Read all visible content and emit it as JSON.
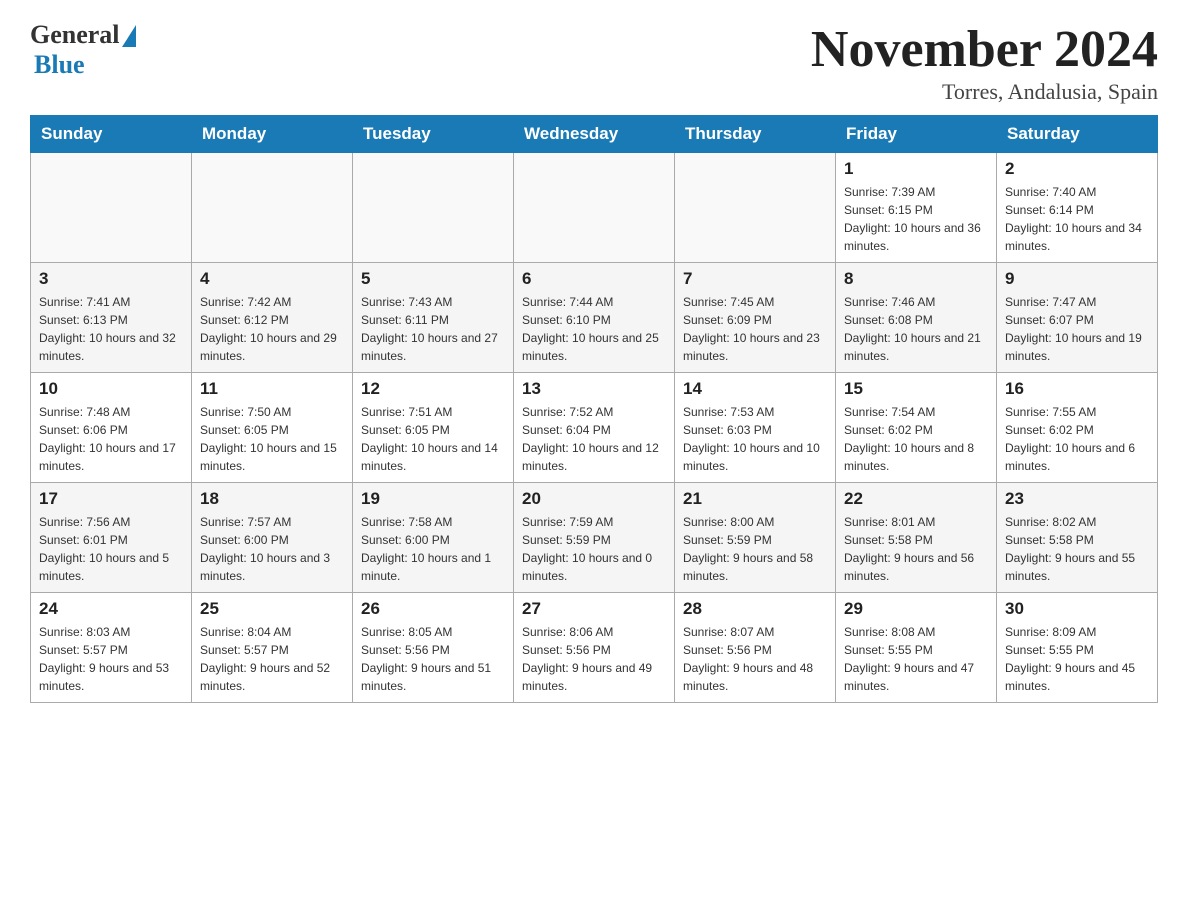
{
  "header": {
    "logo_general": "General",
    "logo_blue": "Blue",
    "month_title": "November 2024",
    "location": "Torres, Andalusia, Spain"
  },
  "weekdays": [
    "Sunday",
    "Monday",
    "Tuesday",
    "Wednesday",
    "Thursday",
    "Friday",
    "Saturday"
  ],
  "weeks": [
    [
      {
        "day": "",
        "info": ""
      },
      {
        "day": "",
        "info": ""
      },
      {
        "day": "",
        "info": ""
      },
      {
        "day": "",
        "info": ""
      },
      {
        "day": "",
        "info": ""
      },
      {
        "day": "1",
        "info": "Sunrise: 7:39 AM\nSunset: 6:15 PM\nDaylight: 10 hours and 36 minutes."
      },
      {
        "day": "2",
        "info": "Sunrise: 7:40 AM\nSunset: 6:14 PM\nDaylight: 10 hours and 34 minutes."
      }
    ],
    [
      {
        "day": "3",
        "info": "Sunrise: 7:41 AM\nSunset: 6:13 PM\nDaylight: 10 hours and 32 minutes."
      },
      {
        "day": "4",
        "info": "Sunrise: 7:42 AM\nSunset: 6:12 PM\nDaylight: 10 hours and 29 minutes."
      },
      {
        "day": "5",
        "info": "Sunrise: 7:43 AM\nSunset: 6:11 PM\nDaylight: 10 hours and 27 minutes."
      },
      {
        "day": "6",
        "info": "Sunrise: 7:44 AM\nSunset: 6:10 PM\nDaylight: 10 hours and 25 minutes."
      },
      {
        "day": "7",
        "info": "Sunrise: 7:45 AM\nSunset: 6:09 PM\nDaylight: 10 hours and 23 minutes."
      },
      {
        "day": "8",
        "info": "Sunrise: 7:46 AM\nSunset: 6:08 PM\nDaylight: 10 hours and 21 minutes."
      },
      {
        "day": "9",
        "info": "Sunrise: 7:47 AM\nSunset: 6:07 PM\nDaylight: 10 hours and 19 minutes."
      }
    ],
    [
      {
        "day": "10",
        "info": "Sunrise: 7:48 AM\nSunset: 6:06 PM\nDaylight: 10 hours and 17 minutes."
      },
      {
        "day": "11",
        "info": "Sunrise: 7:50 AM\nSunset: 6:05 PM\nDaylight: 10 hours and 15 minutes."
      },
      {
        "day": "12",
        "info": "Sunrise: 7:51 AM\nSunset: 6:05 PM\nDaylight: 10 hours and 14 minutes."
      },
      {
        "day": "13",
        "info": "Sunrise: 7:52 AM\nSunset: 6:04 PM\nDaylight: 10 hours and 12 minutes."
      },
      {
        "day": "14",
        "info": "Sunrise: 7:53 AM\nSunset: 6:03 PM\nDaylight: 10 hours and 10 minutes."
      },
      {
        "day": "15",
        "info": "Sunrise: 7:54 AM\nSunset: 6:02 PM\nDaylight: 10 hours and 8 minutes."
      },
      {
        "day": "16",
        "info": "Sunrise: 7:55 AM\nSunset: 6:02 PM\nDaylight: 10 hours and 6 minutes."
      }
    ],
    [
      {
        "day": "17",
        "info": "Sunrise: 7:56 AM\nSunset: 6:01 PM\nDaylight: 10 hours and 5 minutes."
      },
      {
        "day": "18",
        "info": "Sunrise: 7:57 AM\nSunset: 6:00 PM\nDaylight: 10 hours and 3 minutes."
      },
      {
        "day": "19",
        "info": "Sunrise: 7:58 AM\nSunset: 6:00 PM\nDaylight: 10 hours and 1 minute."
      },
      {
        "day": "20",
        "info": "Sunrise: 7:59 AM\nSunset: 5:59 PM\nDaylight: 10 hours and 0 minutes."
      },
      {
        "day": "21",
        "info": "Sunrise: 8:00 AM\nSunset: 5:59 PM\nDaylight: 9 hours and 58 minutes."
      },
      {
        "day": "22",
        "info": "Sunrise: 8:01 AM\nSunset: 5:58 PM\nDaylight: 9 hours and 56 minutes."
      },
      {
        "day": "23",
        "info": "Sunrise: 8:02 AM\nSunset: 5:58 PM\nDaylight: 9 hours and 55 minutes."
      }
    ],
    [
      {
        "day": "24",
        "info": "Sunrise: 8:03 AM\nSunset: 5:57 PM\nDaylight: 9 hours and 53 minutes."
      },
      {
        "day": "25",
        "info": "Sunrise: 8:04 AM\nSunset: 5:57 PM\nDaylight: 9 hours and 52 minutes."
      },
      {
        "day": "26",
        "info": "Sunrise: 8:05 AM\nSunset: 5:56 PM\nDaylight: 9 hours and 51 minutes."
      },
      {
        "day": "27",
        "info": "Sunrise: 8:06 AM\nSunset: 5:56 PM\nDaylight: 9 hours and 49 minutes."
      },
      {
        "day": "28",
        "info": "Sunrise: 8:07 AM\nSunset: 5:56 PM\nDaylight: 9 hours and 48 minutes."
      },
      {
        "day": "29",
        "info": "Sunrise: 8:08 AM\nSunset: 5:55 PM\nDaylight: 9 hours and 47 minutes."
      },
      {
        "day": "30",
        "info": "Sunrise: 8:09 AM\nSunset: 5:55 PM\nDaylight: 9 hours and 45 minutes."
      }
    ]
  ]
}
